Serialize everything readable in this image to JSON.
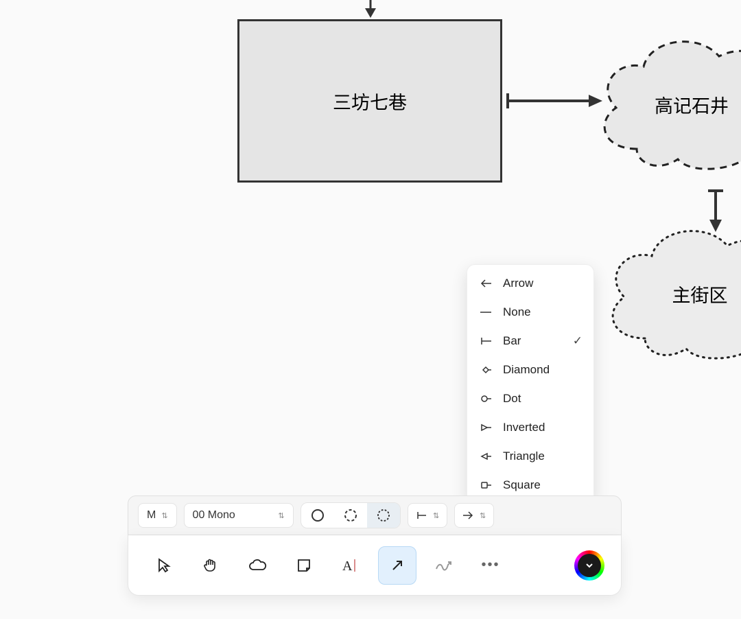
{
  "nodes": {
    "rect": {
      "label": "三坊七巷"
    },
    "cloud1": {
      "label": "高记石井"
    },
    "cloud2": {
      "label": "主街区"
    }
  },
  "arrowheadMenu": {
    "items": [
      {
        "label": "Arrow",
        "icon": "arrow",
        "selected": false
      },
      {
        "label": "None",
        "icon": "none",
        "selected": false
      },
      {
        "label": "Bar",
        "icon": "bar",
        "selected": true
      },
      {
        "label": "Diamond",
        "icon": "diamond",
        "selected": false
      },
      {
        "label": "Dot",
        "icon": "dot",
        "selected": false
      },
      {
        "label": "Inverted",
        "icon": "inverted",
        "selected": false
      },
      {
        "label": "Triangle",
        "icon": "triangle",
        "selected": false
      },
      {
        "label": "Square",
        "icon": "square",
        "selected": false
      }
    ]
  },
  "styleBar": {
    "size": "M",
    "font": "00 Mono"
  },
  "icons": {
    "select": "select-icon",
    "hand": "hand-icon",
    "cloud": "cloud-icon",
    "note": "note-icon",
    "text": "text-icon",
    "arrow": "arrow-icon",
    "draw": "draw-icon",
    "more": "more-icon",
    "color": "color-picker-icon"
  }
}
